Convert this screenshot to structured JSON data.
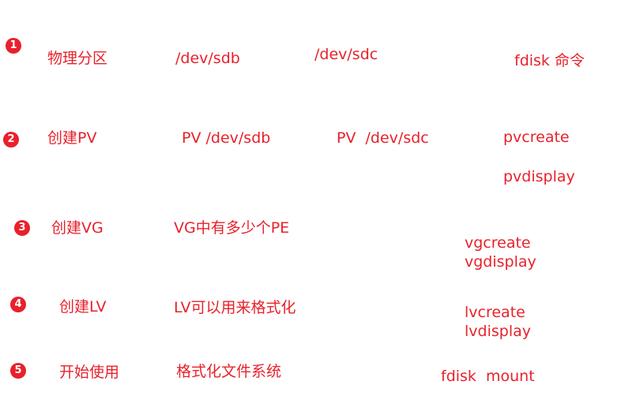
{
  "colors": {
    "accent": "#e8212b",
    "badge_text": "#ffffff",
    "background": "#ffffff"
  },
  "steps": [
    {
      "number": "1",
      "title": "物理分区",
      "items": [
        "/dev/sdb",
        "/dev/sdc"
      ],
      "commands": [
        "fdisk 命令"
      ]
    },
    {
      "number": "2",
      "title": "创建PV",
      "items": [
        "PV /dev/sdb",
        "PV  /dev/sdc"
      ],
      "commands": [
        "pvcreate",
        "pvdisplay"
      ]
    },
    {
      "number": "3",
      "title": "创建VG",
      "items": [
        "VG中有多少个PE"
      ],
      "commands": [
        "vgcreate",
        "vgdisplay"
      ]
    },
    {
      "number": "4",
      "title": "创建LV",
      "items": [
        "LV可以用来格式化"
      ],
      "commands": [
        "lvcreate",
        "lvdisplay"
      ]
    },
    {
      "number": "5",
      "title": "开始使用",
      "items": [
        "格式化文件系统"
      ],
      "commands": [
        "fdisk  mount"
      ]
    }
  ]
}
